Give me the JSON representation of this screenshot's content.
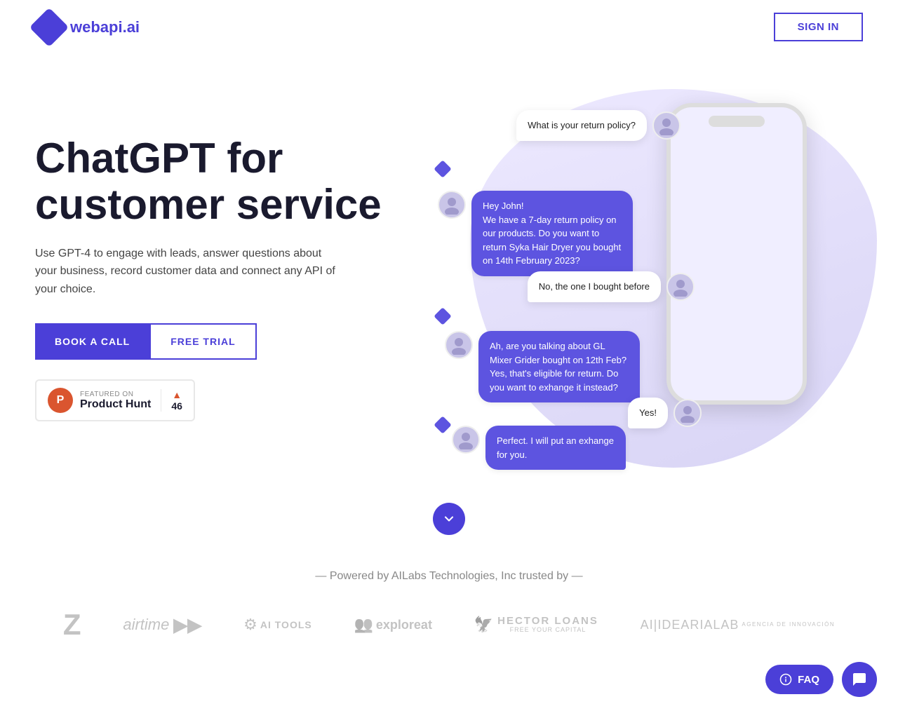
{
  "logo": {
    "text_plain": "webapi.",
    "text_accent": "ai"
  },
  "nav": {
    "signin_label": "SIGN IN"
  },
  "hero": {
    "heading_line1": "ChatGPT for",
    "heading_line2": "customer service",
    "subtext": "Use GPT-4 to engage with leads, answer questions about your business, record customer data and connect any API of your choice.",
    "btn_book": "BOOK A CALL",
    "btn_trial": "FREE TRIAL"
  },
  "product_hunt": {
    "featured_label": "FEATURED ON",
    "name": "Product Hunt",
    "votes": "46"
  },
  "chat_bubbles": [
    {
      "id": "b1",
      "type": "right",
      "text": "What is your return policy?"
    },
    {
      "id": "b2",
      "type": "left",
      "text": "Hey John!\nWe have a 7-day return policy on our products. Do you want to return Syka Hair Dryer you bought on 14th February 2023?"
    },
    {
      "id": "b3",
      "type": "right",
      "text": "No, the one I bought before"
    },
    {
      "id": "b4",
      "type": "left",
      "text": "Ah, are you talking about GL Mixer Grider bought on 12th Feb? Yes, that's eligible for return. Do you want to exhange it instead?"
    },
    {
      "id": "b5",
      "type": "right",
      "text": "Yes!"
    },
    {
      "id": "b6",
      "type": "left",
      "text": "Perfect. I will put an exhange for you."
    }
  ],
  "scroll": {
    "label": "scroll down"
  },
  "trusted": {
    "label": "— Powered by AILabs Technologies, Inc trusted by —"
  },
  "logos": [
    "Z",
    "airtime ▶▶",
    "AI TOOLS",
    "exploreat",
    "HECTOR LOANS",
    "AIIDEARIALAB"
  ],
  "faq": {
    "label": "FAQ"
  }
}
